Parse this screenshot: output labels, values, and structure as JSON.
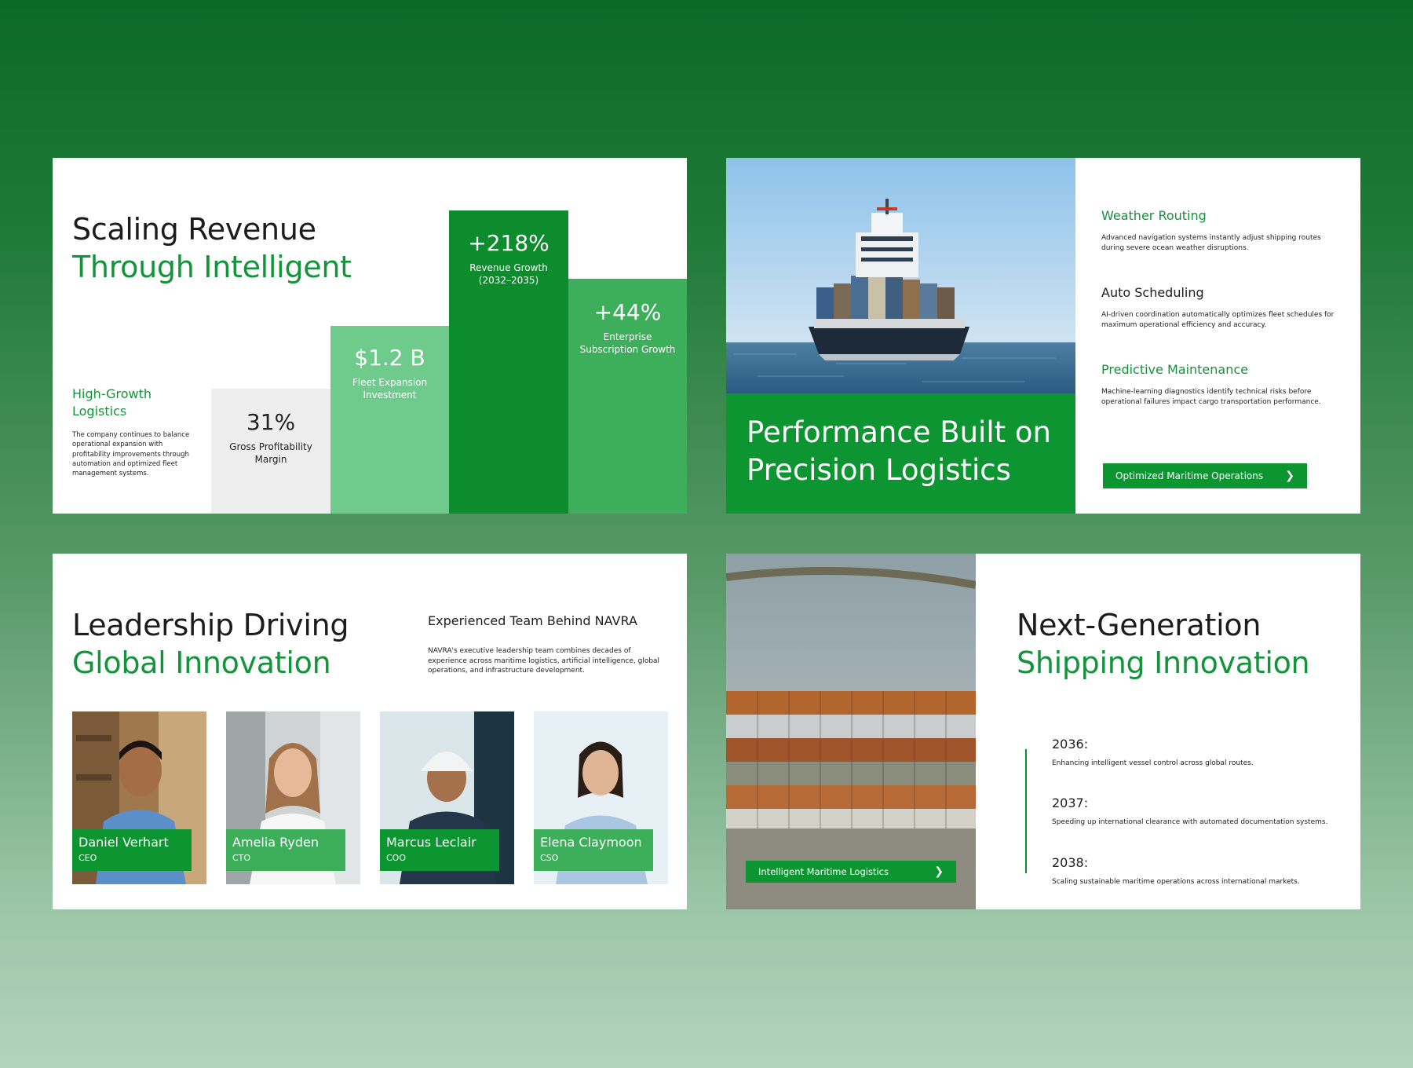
{
  "colors": {
    "accent": "#14943a",
    "accent_dark": "#0c8c2c",
    "accent_light": "#6ecb8c",
    "accent_mid": "#3dae5a",
    "neutral_bar": "#eeeeee"
  },
  "slide1": {
    "title_line1": "Scaling Revenue",
    "title_line2": "Through Intelligent",
    "side_title": "High-Growth Logistics",
    "side_body": "The company continues to balance operational expansion with profitability improvements through automation and optimized fleet management systems.",
    "stats": [
      {
        "value": "31%",
        "label": "Gross Profitability Margin"
      },
      {
        "value": "$1.2 B",
        "label": "Fleet Expansion Investment"
      },
      {
        "value": "+218%",
        "label": "Revenue Growth (2032–2035)"
      },
      {
        "value": "+44%",
        "label": "Enterprise Subscription Growth"
      }
    ]
  },
  "slide2": {
    "title": "Performance Built on Precision Logistics",
    "features": [
      {
        "heading": "Weather Routing",
        "body": "Advanced navigation systems instantly adjust shipping routes during severe ocean weather disruptions."
      },
      {
        "heading": "Auto Scheduling",
        "body": "AI-driven coordination automatically optimizes fleet schedules for maximum operational efficiency and accuracy."
      },
      {
        "heading": "Predictive Maintenance",
        "body": "Machine-learning diagnostics identify technical risks before operational failures impact cargo transportation performance."
      }
    ],
    "button_label": "Optimized Maritime Operations",
    "button_icon": "chevron-right-icon"
  },
  "slide3": {
    "title_line1": "Leadership Driving",
    "title_line2": "Global Innovation",
    "team_heading": "Experienced Team Behind NAVRA",
    "team_body": "NAVRA's executive leadership team combines decades of experience across maritime logistics, artificial intelligence, global operations, and infrastructure development.",
    "people": [
      {
        "name": "Daniel Verhart",
        "role": "CEO"
      },
      {
        "name": "Amelia Ryden",
        "role": "CTO"
      },
      {
        "name": "Marcus Leclair",
        "role": "COO"
      },
      {
        "name": "Elena Claymoon",
        "role": "CSO"
      }
    ]
  },
  "slide4": {
    "title_line1": "Next-Generation",
    "title_line2": "Shipping Innovation",
    "button_label": "Intelligent Maritime Logistics",
    "button_icon": "chevron-right-icon",
    "timeline": [
      {
        "year": "2036:",
        "text": "Enhancing intelligent vessel control across global routes."
      },
      {
        "year": "2037:",
        "text": "Speeding up international clearance with automated documentation systems."
      },
      {
        "year": "2038:",
        "text": "Scaling sustainable maritime operations across international markets."
      }
    ]
  }
}
